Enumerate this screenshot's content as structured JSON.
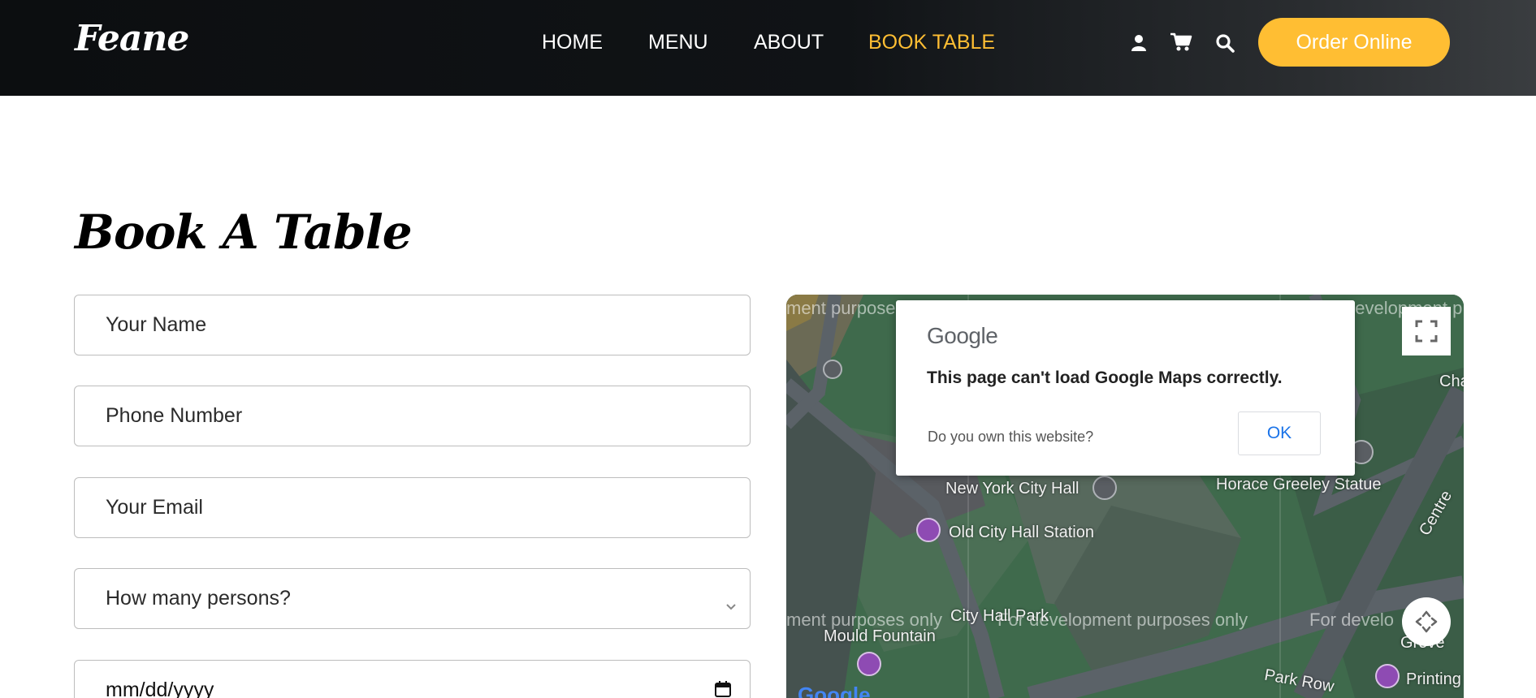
{
  "header": {
    "logo": "Feane",
    "nav": [
      {
        "label": "HOME",
        "active": false
      },
      {
        "label": "MENU",
        "active": false
      },
      {
        "label": "ABOUT",
        "active": false
      },
      {
        "label": "BOOK TABLE",
        "active": true
      }
    ],
    "icons": [
      "user-icon",
      "cart-icon",
      "search-icon"
    ],
    "order_button": "Order Online"
  },
  "section": {
    "title": "Book A Table"
  },
  "form": {
    "name_placeholder": "Your Name",
    "phone_placeholder": "Phone Number",
    "email_placeholder": "Your Email",
    "persons_select": "How many persons?",
    "date_placeholder": "mm/dd/yyyy"
  },
  "map": {
    "dialog": {
      "brand": "Google",
      "message": "This page can't load Google Maps correctly.",
      "question": "Do you own this website?",
      "ok": "OK"
    },
    "watermarks": [
      "ment purposes",
      "development p",
      "ment purposes only",
      "For development purposes only",
      "For develo"
    ],
    "labels": [
      {
        "text": "New York City Hall"
      },
      {
        "text": "Horace Greeley Statue"
      },
      {
        "text": "Old City Hall Station"
      },
      {
        "text": "City Hall Park"
      },
      {
        "text": "Mould Fountain"
      },
      {
        "text": "Park Row"
      },
      {
        "text": "Centre"
      },
      {
        "text": "Cha"
      },
      {
        "text": "Printing"
      },
      {
        "text": "Grove"
      }
    ],
    "google_mark": "Google"
  },
  "colors": {
    "accent": "#ffbe33",
    "header_bg": "#0c0e10",
    "map_green": "#3d5f47"
  }
}
